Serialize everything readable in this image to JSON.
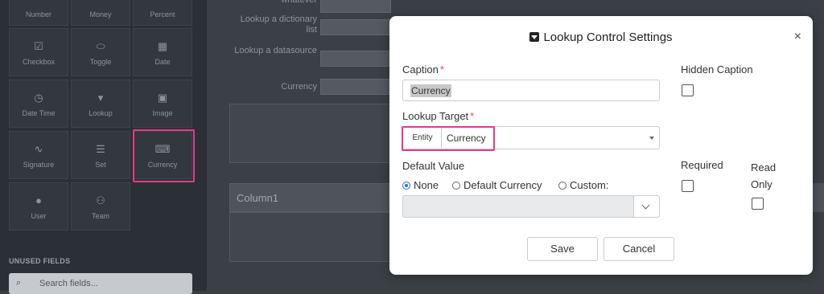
{
  "palette": {
    "tiles": [
      {
        "label": "Number",
        "icon": "number-icon"
      },
      {
        "label": "Money",
        "icon": "money-icon"
      },
      {
        "label": "Percent",
        "icon": "percent-icon"
      },
      {
        "label": "Checkbox",
        "icon": "checkbox-icon",
        "glyph": "☑"
      },
      {
        "label": "Toggle",
        "icon": "toggle-icon",
        "glyph": "⬭"
      },
      {
        "label": "Date",
        "icon": "calendar-icon",
        "glyph": "▦"
      },
      {
        "label": "Date Time",
        "icon": "clock-icon",
        "glyph": "◷"
      },
      {
        "label": "Lookup",
        "icon": "lookup-icon",
        "glyph": "▾"
      },
      {
        "label": "Image",
        "icon": "image-icon",
        "glyph": "▣"
      },
      {
        "label": "Signature",
        "icon": "signature-icon",
        "glyph": "∿"
      },
      {
        "label": "Set",
        "icon": "list-icon",
        "glyph": "☰"
      },
      {
        "label": "Currency",
        "icon": "currency-icon",
        "glyph": "⌨"
      },
      {
        "label": "User",
        "icon": "user-icon",
        "glyph": "●"
      },
      {
        "label": "Team",
        "icon": "team-icon",
        "glyph": "⚇"
      }
    ],
    "unused_fields_heading": "UNUSED FIELDS",
    "search_placeholder": "Search fields..."
  },
  "background_form": {
    "labels": [
      "whatever",
      "Lookup a dictionary list",
      "Lookup a datasource",
      "Currency"
    ],
    "column_header": "Column1"
  },
  "modal": {
    "title": "Lookup Control Settings",
    "close_glyph": "×",
    "caption_label": "Caption",
    "caption_value": "Currency",
    "hidden_caption_label": "Hidden Caption",
    "lookup_target_label": "Lookup Target",
    "lookup_target_type": "Entity",
    "lookup_target_value": "Currency",
    "default_value_label": "Default Value",
    "radio_options": [
      "None",
      "Default Currency",
      "Custom:"
    ],
    "radio_selected": "None",
    "required_label": "Required",
    "read_only_label": "Read Only",
    "required_mark": "*",
    "save_label": "Save",
    "cancel_label": "Cancel"
  },
  "colors": {
    "highlight": "#e8388a",
    "radio_selected": "#2a6fdb",
    "required_mark": "#d9534f"
  }
}
